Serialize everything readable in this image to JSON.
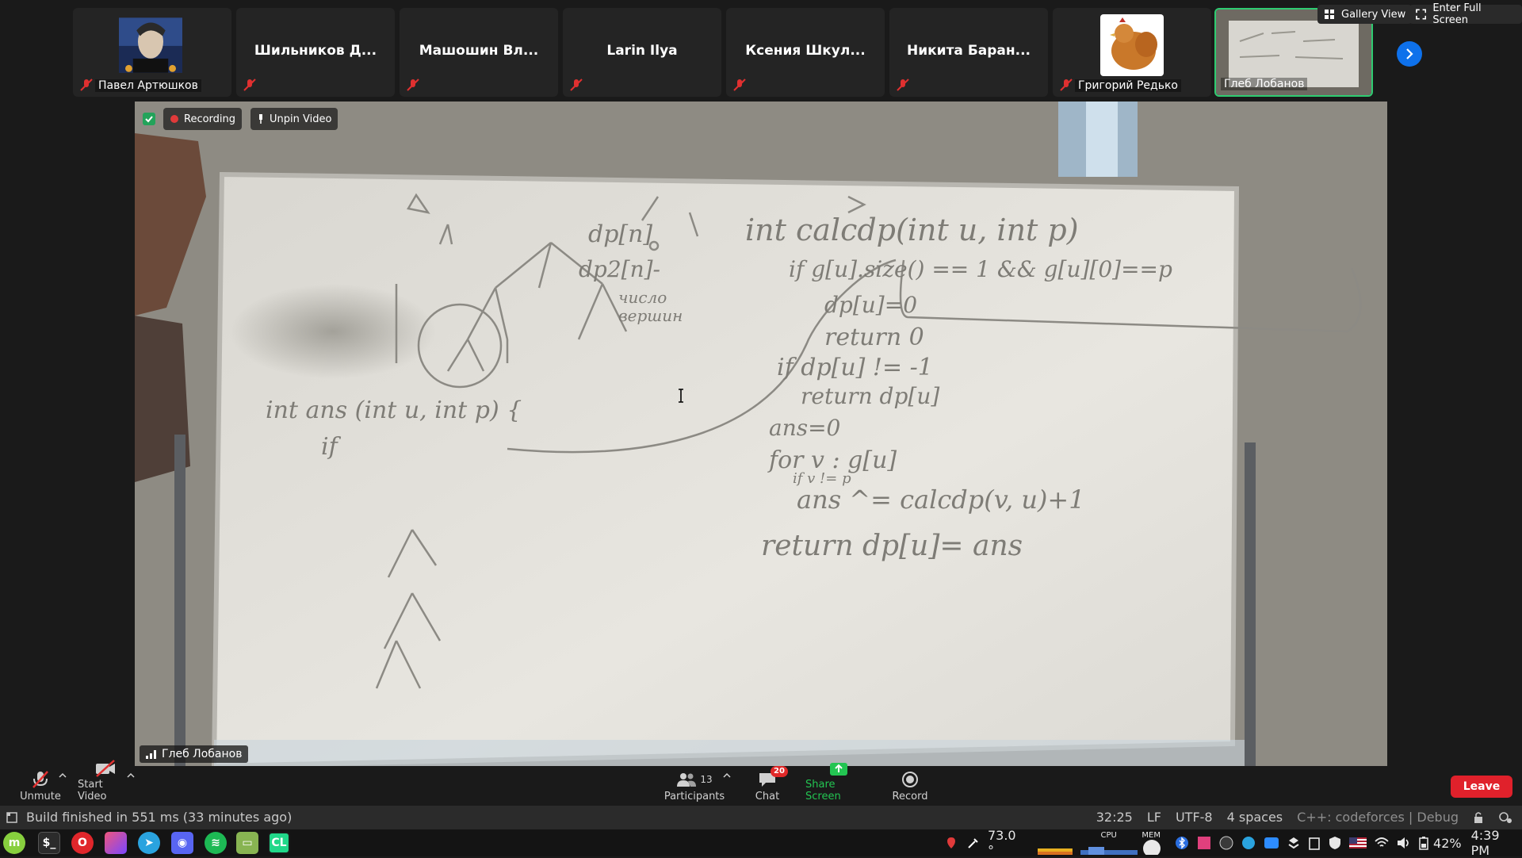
{
  "participants": [
    {
      "name": "Павел Артюшков",
      "has_image": true,
      "image": "avatar-illustration",
      "muted": true
    },
    {
      "name": "Шильников Д...",
      "caption": "",
      "muted": true
    },
    {
      "name": "Машошин Вл...",
      "caption": "",
      "muted": true
    },
    {
      "name": "Larin Ilya",
      "caption": "",
      "muted": true
    },
    {
      "name": "Ксения Шкул...",
      "caption": "",
      "muted": true
    },
    {
      "name": "Никита Баран...",
      "caption": "",
      "muted": true
    },
    {
      "name": "Григорий Редько",
      "has_image": true,
      "image": "chicken-photo",
      "muted": true
    },
    {
      "name": "Глеб Лобанов",
      "has_image": true,
      "image": "whiteboard-video",
      "muted": false,
      "active": true
    }
  ],
  "top_right": {
    "gallery_view": "Gallery View",
    "enter_full_screen": "Enter Full Screen"
  },
  "video": {
    "recording_label": "Recording",
    "unpin_label": "Unpin Video",
    "speaker_name": "Глеб Лобанов",
    "whiteboard": {
      "left": {
        "line1": "int ans (int u, int p) {",
        "line2": "if"
      },
      "middle": {
        "dp1": "dp[n]",
        "dp2": "dp2[n]-",
        "note1": "число",
        "note2": "вершин"
      },
      "right": {
        "header": "int calcdp(int u, int p)",
        "l1": "if g[u].size() == 1 && g[u][0]==p",
        "l2": "dp[u]=0",
        "l3": "return 0",
        "l4": "if dp[u] != -1",
        "l5": "return dp[u]",
        "l6": "ans=0",
        "l7": "for v : g[u]",
        "l7b": "if v != p",
        "l8": "ans ^= calcdp(v, u)+1",
        "l9": "return dp[u]= ans"
      }
    }
  },
  "controls": {
    "unmute": "Unmute",
    "start_video": "Start Video",
    "participants": "Participants",
    "participants_count": "13",
    "chat": "Chat",
    "chat_badge": "20",
    "share_screen": "Share Screen",
    "record": "Record",
    "leave": "Leave"
  },
  "status_bar": {
    "build": "Build finished in 551 ms (33 minutes ago)",
    "position": "32:25",
    "line_sep": "LF",
    "encoding": "UTF-8",
    "indent": "4 spaces",
    "context": "C++: codeforces | Debug"
  },
  "taskbar": {
    "apps": [
      "mint-menu-icon",
      "terminal-icon",
      "opera-icon",
      "jetbrains-toolbox-icon",
      "telegram-icon",
      "discord-icon",
      "spotify-icon",
      "files-icon",
      "clion-icon"
    ],
    "temperature": "73.0 °",
    "cpu_label": "CPU",
    "mem_label": "MEM",
    "battery": "42%",
    "time": "4:39 PM"
  },
  "colors": {
    "zoom_blue": "#0e71eb",
    "leave_red": "#e0212b",
    "share_green": "#23c552",
    "active_border": "#2ecc71"
  }
}
